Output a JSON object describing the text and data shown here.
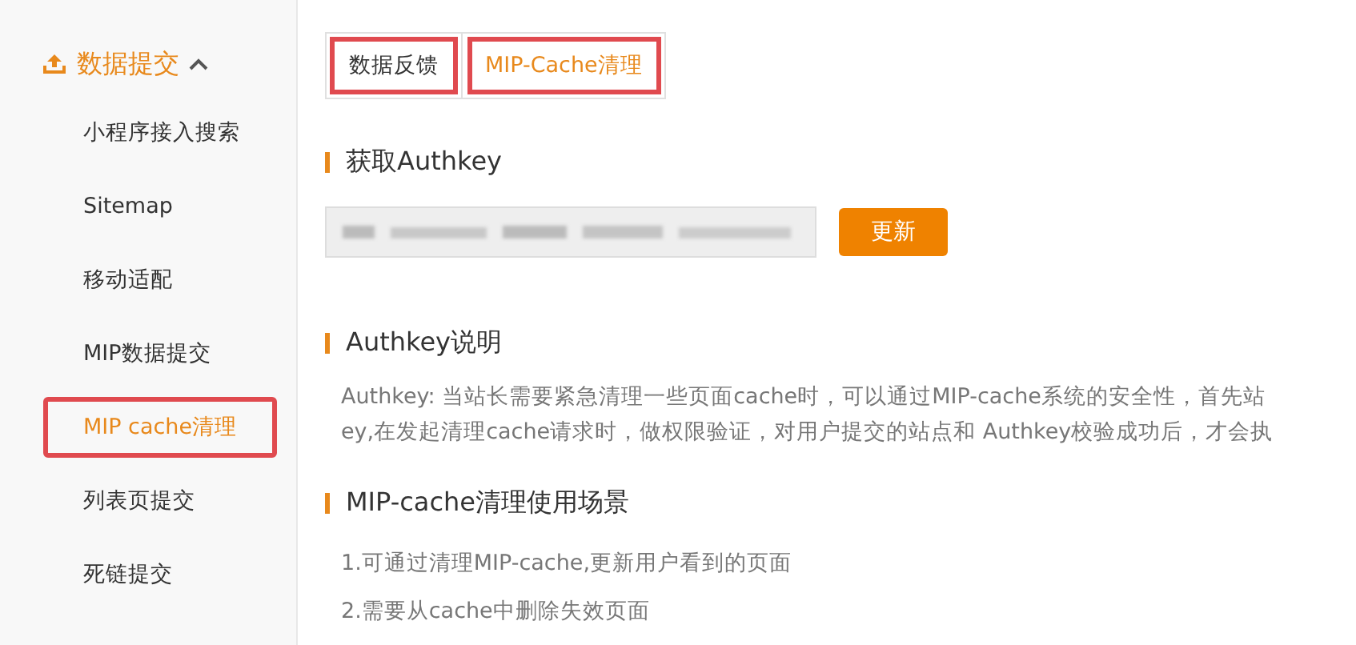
{
  "sidebar": {
    "group": {
      "label": "数据提交",
      "expanded": true
    },
    "items": [
      {
        "label": "小程序接入搜索",
        "selected": false,
        "highlighted": false
      },
      {
        "label": "Sitemap",
        "selected": false,
        "highlighted": false
      },
      {
        "label": "移动适配",
        "selected": false,
        "highlighted": false
      },
      {
        "label": "MIP数据提交",
        "selected": false,
        "highlighted": false
      },
      {
        "label": "MIP cache清理",
        "selected": true,
        "highlighted": true
      },
      {
        "label": "列表页提交",
        "selected": false,
        "highlighted": false
      },
      {
        "label": "死链提交",
        "selected": false,
        "highlighted": false
      }
    ]
  },
  "tabs": [
    {
      "label": "数据反馈",
      "selected": false,
      "highlighted": true
    },
    {
      "label": "MIP-Cache清理",
      "selected": true,
      "highlighted": true
    }
  ],
  "sections": [
    {
      "kind": "key",
      "title": "获取Authkey",
      "button": "更新"
    },
    {
      "kind": "text",
      "title": "Authkey说明",
      "lines": [
        "Authkey: 当站长需要紧急清理一些页面cache时，可以通过MIP-cache系统的安全性，首先站",
        "ey,在发起清理cache请求时，做权限验证，对用户提交的站点和 Authkey校验成功后，才会执"
      ]
    },
    {
      "kind": "text",
      "title": "MIP-cache清理使用场景",
      "lines": [
        "1.可通过清理MIP-cache,更新用户看到的页面",
        "2.需要从cache中删除失效页面"
      ]
    }
  ]
}
